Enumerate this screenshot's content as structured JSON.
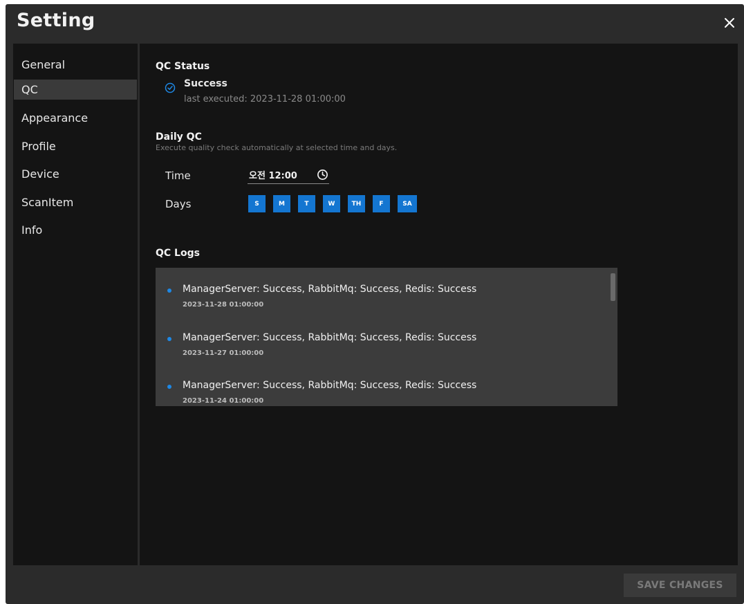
{
  "window": {
    "title": "Setting"
  },
  "sidebar": {
    "items": [
      {
        "label": "General",
        "active": false
      },
      {
        "label": "QC",
        "active": true
      },
      {
        "label": "Appearance",
        "active": false
      },
      {
        "label": "Profile",
        "active": false
      },
      {
        "label": "Device",
        "active": false
      },
      {
        "label": "ScanItem",
        "active": false
      },
      {
        "label": "Info",
        "active": false
      }
    ]
  },
  "qc_status": {
    "title": "QC Status",
    "status": "Success",
    "status_icon": "check-circle-icon",
    "last_executed": "last executed: 2023-11-28 01:00:00"
  },
  "daily_qc": {
    "title": "Daily QC",
    "description": "Execute quality check automatically at selected time and days.",
    "time_label": "Time",
    "time_value": "오전 12:00",
    "days_label": "Days",
    "days": [
      "S",
      "M",
      "T",
      "W",
      "TH",
      "F",
      "SA"
    ],
    "days_selected": [
      true,
      true,
      true,
      true,
      true,
      true,
      true
    ]
  },
  "qc_logs": {
    "title": "QC Logs",
    "entries": [
      {
        "message": "ManagerServer: Success, RabbitMq: Success, Redis: Success",
        "date": "2023-11-28 01:00:00"
      },
      {
        "message": "ManagerServer: Success, RabbitMq: Success, Redis: Success",
        "date": "2023-11-27 01:00:00"
      },
      {
        "message": "ManagerServer: Success, RabbitMq: Success, Redis: Success",
        "date": "2023-11-24 01:00:00"
      }
    ]
  },
  "footer": {
    "save_label": "SAVE CHANGES"
  },
  "colors": {
    "accent": "#1476d1",
    "background": "#2b2b2b",
    "panel": "#141414",
    "log_bullet": "#1e88e5"
  }
}
